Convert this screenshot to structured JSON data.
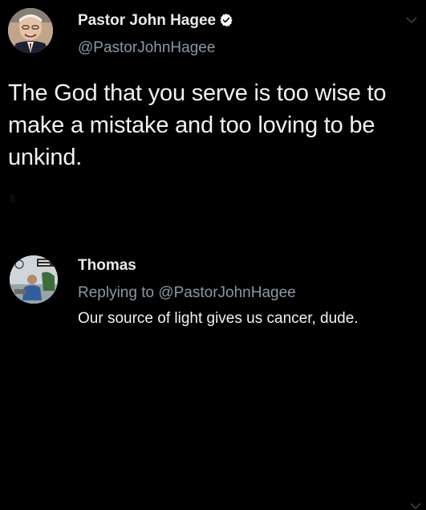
{
  "tweet": {
    "author_name": "Pastor John Hagee",
    "author_handle": "@PastorJohnHagee",
    "text": "The God that you serve is too wise to make a mistake and too loving to be unkind.",
    "faint_text": "8"
  },
  "reply": {
    "author_name": "Thomas",
    "replying_prefix": "Replying to ",
    "replying_handle": "@PastorJohnHagee",
    "text": "Our source of light gives us cancer, dude."
  },
  "icons": {
    "verified": "verified-badge-icon",
    "menu": "chevron-down-icon"
  },
  "colors": {
    "background": "#000000",
    "primary_text": "#e7e9ea",
    "secondary_text": "#8b98a5"
  }
}
